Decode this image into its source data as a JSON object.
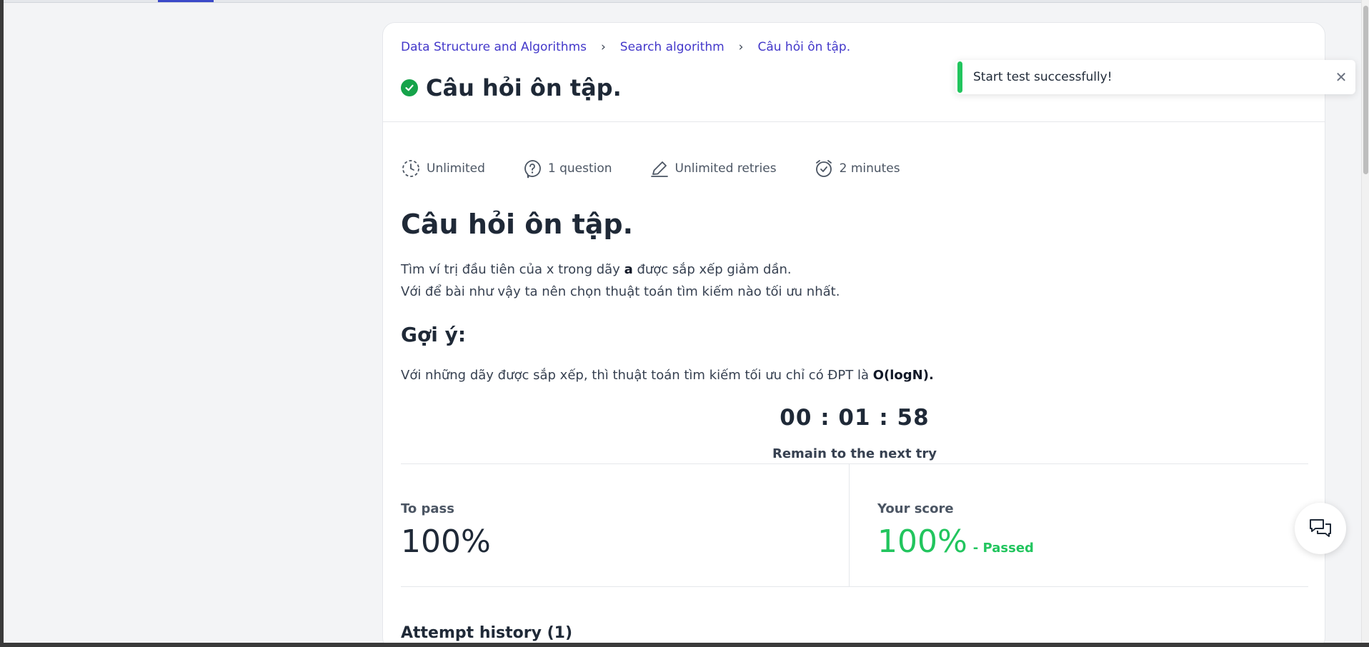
{
  "breadcrumb": {
    "items": [
      "Data Structure and Algorithms",
      "Search algorithm",
      "Câu hỏi ôn tập."
    ]
  },
  "page": {
    "title": "Câu hỏi ôn tập.",
    "meta": {
      "time_limit": "Unlimited",
      "questions": "1 question",
      "retries": "Unlimited retries",
      "duration": "2 minutes"
    }
  },
  "content": {
    "heading": "Câu hỏi ôn tập.",
    "desc_line1_pre": "Tìm ví trị đầu tiên của x trong dãy ",
    "desc_line1_bold": "a",
    "desc_line1_post": " được sắp xếp giảm dần.",
    "desc_line2": "Với để bài như vậy ta nên chọn thuật toán tìm kiếm nào tối ưu nhất.",
    "hint_title": "Gợi ý:",
    "hint_pre": "Với những dãy được sắp xếp, thì thuật toán tìm kiếm tối ưu chỉ có ĐPT là ",
    "hint_bold": "O(logN)."
  },
  "timer": {
    "value": "00 : 01 : 58",
    "label": "Remain to the next try"
  },
  "score": {
    "to_pass_label": "To pass",
    "to_pass_value": "100%",
    "your_score_label": "Your score",
    "your_score_value": "100%",
    "status": "- Passed"
  },
  "attempt_history": "Attempt history (1)",
  "toast": {
    "message": "Start test successfully!",
    "accent": "#22c55e"
  },
  "icons": {
    "title_status": "check-circle-icon",
    "chat": "chat-icon"
  }
}
